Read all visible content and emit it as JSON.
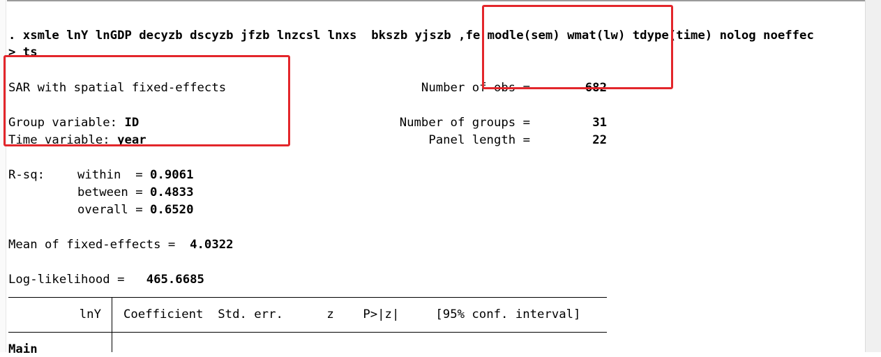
{
  "command": {
    "line1": ". xsmle lnY lnGDP decyzb dscyzb jfzb lnzcsl lnxs  bkszb yjszb ,fe modle(sem) wmat(lw) tdype(time) nolog noeffec",
    "line2": "> ts"
  },
  "header": {
    "model_title": "SAR with spatial fixed-effects",
    "group_label": "Group variable: ",
    "group_value": "ID",
    "time_label": "Time variable: ",
    "time_value": "year",
    "nobs_label": "Number of obs =",
    "nobs_value": "682",
    "ngroups_label": "Number of groups =",
    "ngroups_value": "31",
    "panel_label": "Panel length =",
    "panel_value": "22"
  },
  "rsq": {
    "label": "R-sq:",
    "within_label": "within  =",
    "within_value": "0.9061",
    "between_label": "between =",
    "between_value": "0.4833",
    "overall_label": "overall =",
    "overall_value": "0.6520"
  },
  "fe_mean": {
    "label": "Mean of fixed-effects =",
    "value": "4.0322"
  },
  "loglik": {
    "label": "Log-likelihood =",
    "value": "465.6685"
  },
  "table": {
    "depvar": "lnY",
    "headers": "Coefficient  Std. err.      z    P>|z|     [95% conf. interval]",
    "first_row": "Main"
  },
  "colors": {
    "highlight": "#e3262b",
    "text": "#000000",
    "background": "#ffffff"
  }
}
